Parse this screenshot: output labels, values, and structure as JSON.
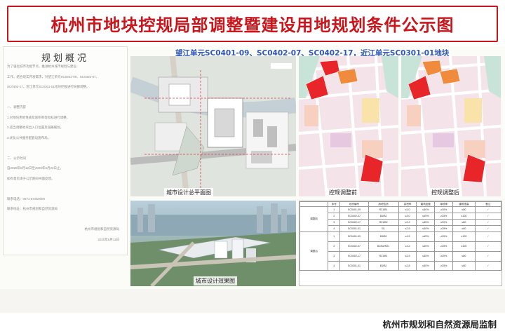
{
  "title": "杭州市地块控规局部调整暨建设用地规划条件公示图",
  "overview": {
    "heading": "规划概况",
    "lines": [
      "为了强化城市功能节点，推进杭州城市规划与建设",
      "工作，结合现实开发需求，对望江单元SC0401-09、SC0402-07、",
      "SC0402-17，近江单元SC0301-01地块控规进行局部调整。",
      "",
      "一、调整内容",
      "  1.对地块用地性质及容积率等指标进行调整，",
      "  2.适当调整地块出入口位置及道路规划，",
      "  3.优化公共服务配套设施布局。",
      "",
      "二、公示时间",
      "  自2020年6月12日至2020年6月22日止，",
      "  如有意见请于公示期间书面反馈。",
      "",
      "联系电话：0571-87250000",
      "联系地址：杭州市规划和自然资源局",
      "",
      "杭州市规划和自然资源局",
      "2020年6月11日"
    ]
  },
  "right_title": "望江单元SC0401-09、SC0402-07、SC0402-17，近江单元SC0301-01地块",
  "captions": {
    "site_plan": "城市设计总平面图",
    "before": "控规调整前",
    "after": "控规调整后",
    "render": "城市设计效果图"
  },
  "table": {
    "headers": [
      "序号",
      "地块编号",
      "用地性质",
      "容积率",
      "建筑密度",
      "绿地率",
      "建筑限高",
      "备注"
    ],
    "section1_label": "调整前",
    "section2_label": "调整后",
    "rows_before": [
      [
        "1",
        "SC0401-09",
        "R21/B1",
        "≤3.0",
        "≤30%",
        "≥30%",
        "≤80",
        "/"
      ],
      [
        "2",
        "SC0402-07",
        "B1/B2",
        "≤4.0",
        "≤45%",
        "≥25%",
        "≤100",
        "/"
      ],
      [
        "3",
        "SC0402-17",
        "R21/B2",
        "≤3.2",
        "≤35%",
        "≥30%",
        "≤80",
        "/"
      ],
      [
        "4",
        "SC0301-01",
        "B1",
        "≤2.5",
        "≤40%",
        "≥25%",
        "≤60",
        "/"
      ]
    ],
    "rows_after": [
      [
        "1",
        "SC0401-09",
        "B1/B2",
        "≤4.5",
        "≤45%",
        "≥25%",
        "≤120",
        "/"
      ],
      [
        "2",
        "SC0402-07",
        "B1/B2/R21",
        "≤4.2",
        "≤45%",
        "≥25%",
        "≤100",
        "/"
      ],
      [
        "3",
        "SC0402-17",
        "R21/B1",
        "≤3.5",
        "≤35%",
        "≥30%",
        "≤80",
        "/"
      ],
      [
        "4",
        "SC0301-01",
        "B1/B2",
        "≤2.8",
        "≤40%",
        "≥25%",
        "≤60",
        "/"
      ]
    ]
  },
  "footer": "杭州市规划和自然资源局监制",
  "colors": {
    "title_red": "#c9161c",
    "subtitle_blue": "#2d57b8",
    "parcel_red": "#e8262a",
    "parcel_orange": "#f08a3c"
  }
}
